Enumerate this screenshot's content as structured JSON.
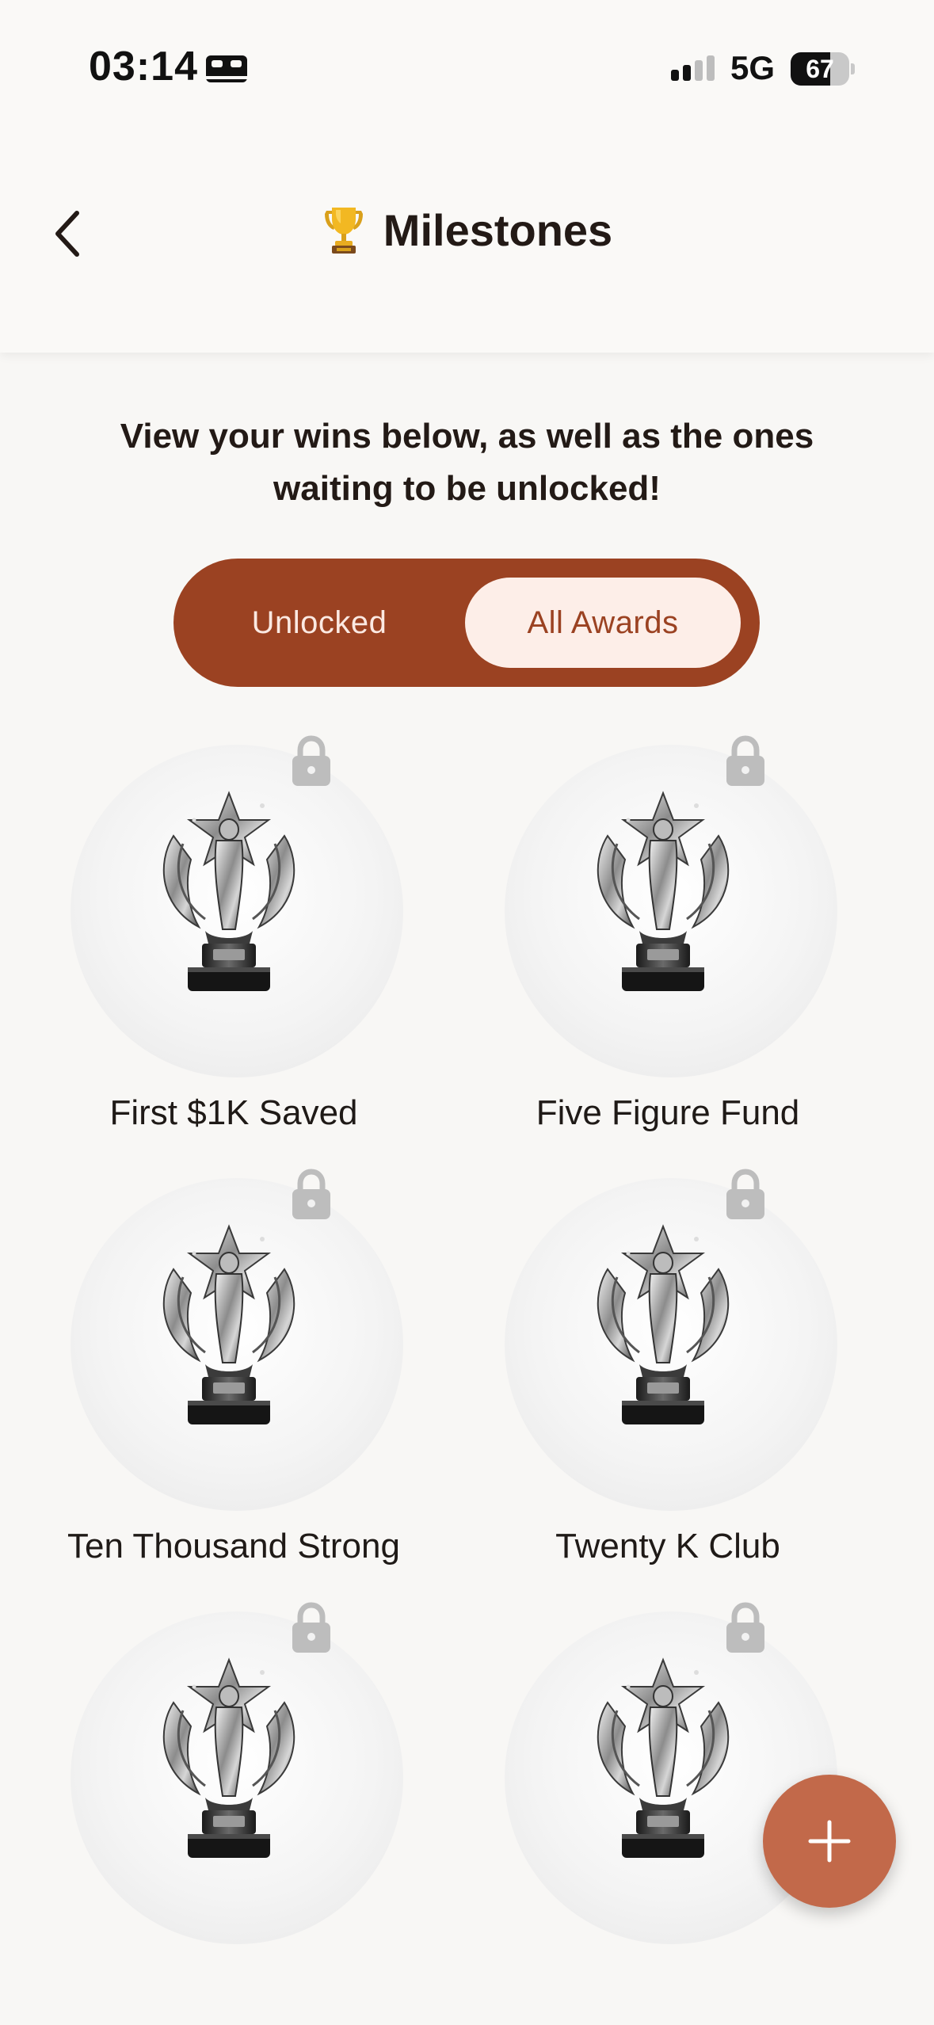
{
  "status_bar": {
    "time": "03:14",
    "network": "5G",
    "battery_level": 67,
    "battery_label": "67",
    "focus_icon": "bed-icon",
    "signal_icon": "cellular-signal-icon"
  },
  "header": {
    "title": "Milestones",
    "title_icon": "trophy-icon",
    "back_icon": "chevron-left-icon"
  },
  "description": "View your wins below, as well as the ones waiting to be unlocked!",
  "segmented_control": {
    "options": [
      "Unlocked",
      "All Awards"
    ],
    "selected": "All Awards"
  },
  "awards": [
    {
      "label": "First $1K Saved",
      "locked": true
    },
    {
      "label": "Five Figure Fund",
      "locked": true
    },
    {
      "label": "Ten Thousand Strong",
      "locked": true
    },
    {
      "label": "Twenty K Club",
      "locked": true
    },
    {
      "label": "",
      "locked": true
    },
    {
      "label": "",
      "locked": true
    }
  ],
  "fab": {
    "icon": "plus-icon"
  },
  "colors": {
    "accent_dark": "#9b4222",
    "accent_light": "#fdeee8",
    "fab": "#c2694a",
    "background": "#f8f7f5"
  }
}
